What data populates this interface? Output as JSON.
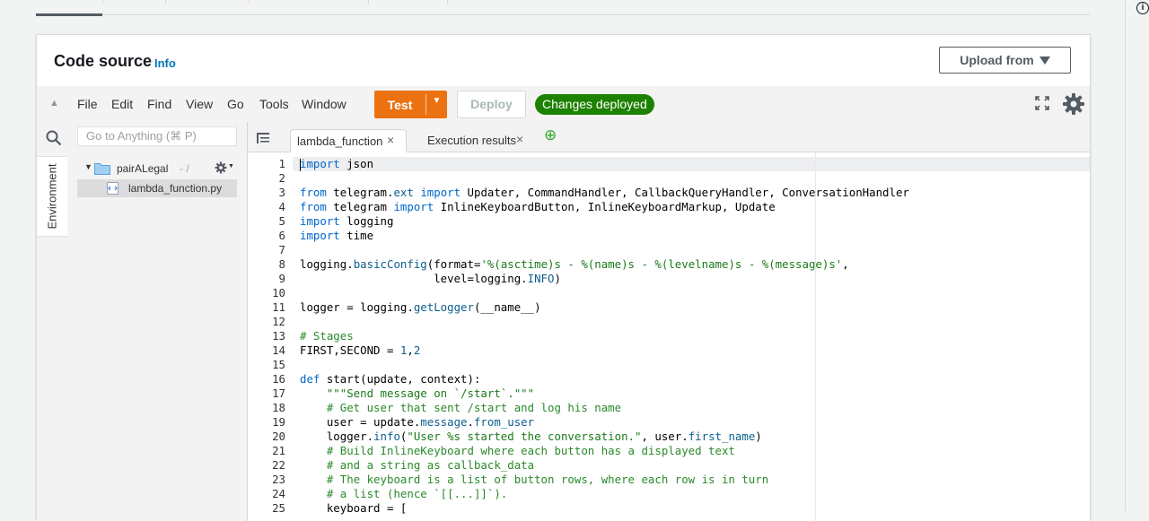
{
  "panel": {
    "title": "Code source",
    "info": "Info",
    "upload_label": "Upload from"
  },
  "menu": [
    "File",
    "Edit",
    "Find",
    "View",
    "Go",
    "Tools",
    "Window"
  ],
  "toolbar": {
    "test_label": "Test",
    "deploy_label": "Deploy",
    "status_badge": "Changes deployed"
  },
  "sidebar": {
    "env_label": "Environment",
    "goto_placeholder": "Go to Anything (⌘ P)",
    "folder": {
      "name": "pairALegal",
      "suffix": "- /"
    },
    "file": "lambda_function.py"
  },
  "editor_tabs": [
    {
      "label": "lambda_function",
      "close": "×"
    },
    {
      "label": "Execution results",
      "close": "×"
    }
  ],
  "add_tab_glyph": "⊕",
  "code_lines": [
    "import json",
    "",
    "from telegram.ext import Updater, CommandHandler, CallbackQueryHandler, ConversationHandler",
    "from telegram import InlineKeyboardButton, InlineKeyboardMarkup, Update",
    "import logging",
    "import time",
    "",
    "logging.basicConfig(format='%(asctime)s - %(name)s - %(levelname)s - %(message)s',",
    "                    level=logging.INFO)",
    "",
    "logger = logging.getLogger(__name__)",
    "",
    "# Stages",
    "FIRST,SECOND = 1,2",
    "",
    "def start(update, context):",
    "    \"\"\"Send message on `/start`.\"\"\"",
    "    # Get user that sent /start and log his name",
    "    user = update.message.from_user",
    "    logger.info(\"User %s started the conversation.\", user.first_name)",
    "    # Build InlineKeyboard where each button has a displayed text",
    "    # and a string as callback_data",
    "    # The keyboard is a list of button rows, where each row is in turn",
    "    # a list (hence `[[...]]`).",
    "    keyboard = ["
  ],
  "colors": {
    "accent_orange": "#ec7211",
    "success_green": "#1d8102",
    "link_blue": "#0073bb",
    "keyword_blue": "#0066cc"
  }
}
